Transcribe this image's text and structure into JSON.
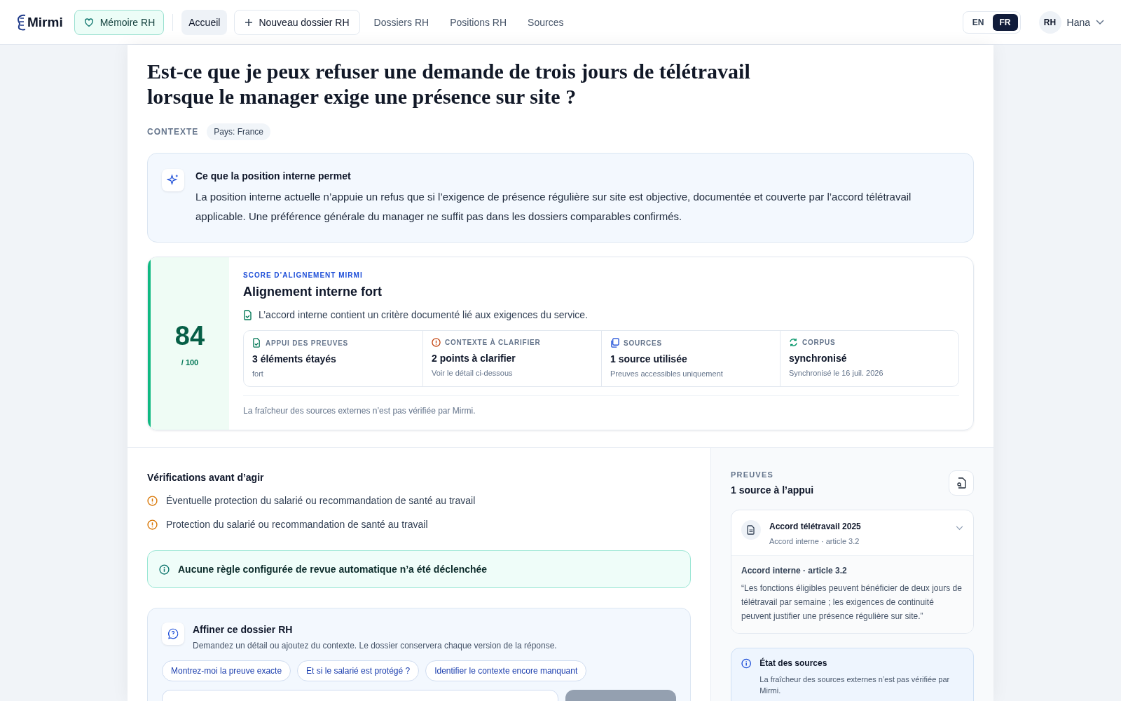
{
  "nav": {
    "logo": "Mirmi",
    "memory_badge": "Mémoire RH",
    "items": [
      {
        "label": "Accueil",
        "kind": "tab",
        "selected": true
      },
      {
        "label": "Nouveau dossier RH",
        "kind": "action",
        "selected": false
      },
      {
        "label": "Dossiers RH",
        "kind": "tab",
        "selected": false
      },
      {
        "label": "Positions RH",
        "kind": "tab",
        "selected": false
      },
      {
        "label": "Sources",
        "kind": "tab",
        "selected": false
      }
    ],
    "languages": [
      {
        "label": "EN",
        "selected": false
      },
      {
        "label": "FR",
        "selected": true
      }
    ],
    "user": {
      "initials": "RH",
      "name": "Hana"
    }
  },
  "question": "Est-ce que je peux refuser une demande de trois jours de télétravail lorsque le manager exige une présence sur site ?",
  "context": {
    "label": "CONTEXTE",
    "tags": [
      "Pays: France"
    ]
  },
  "summary": {
    "title": "Ce que la position interne permet",
    "text": "La position interne actuelle n’appuie un refus que si l’exigence de présence régulière sur site est objective, documentée et couverte par l’accord télétravail applicable. Une préférence générale du manager ne suffit pas dans les dossiers comparables confirmés."
  },
  "score": {
    "value": "84",
    "scale": "/ 100",
    "eyebrow": "SCORE D’ALIGNEMENT MIRMI",
    "title": "Alignement interne fort",
    "note": "L’accord interne contient un critère documenté lié aux exigences du service.",
    "metrics": [
      {
        "kind": "evidence",
        "label": "APPUI DES PREUVES",
        "value": "3 éléments étayés",
        "detail": "fort"
      },
      {
        "kind": "warning",
        "label": "CONTEXTE À CLARIFIER",
        "value": "2 points à clarifier",
        "detail": "Voir le détail ci-dessous"
      },
      {
        "kind": "sources",
        "label": "SOURCES",
        "value": "1 source utilisée",
        "detail": "Preuves accessibles uniquement"
      },
      {
        "kind": "sync",
        "label": "CORPUS",
        "value": "synchronisé",
        "detail": "Synchronisé le 16 juil. 2026"
      }
    ],
    "footer": "La fraîcheur des sources externes n’est pas vérifiée par Mirmi."
  },
  "checks": {
    "title": "Vérifications avant d’agir",
    "items": [
      "Éventuelle protection du salarié ou recommandation de santé au travail",
      "Protection du salarié ou recommandation de santé au travail"
    ]
  },
  "notice": "Aucune règle configurée de revue automatique n’a été déclenchée",
  "refine": {
    "title": "Affiner ce dossier RH",
    "text": "Demandez un détail ou ajoutez du contexte. Le dossier conservera chaque version de la réponse.",
    "suggestions": [
      "Montrez-moi la preuve exacte",
      "Et si le salarié est protégé ?",
      "Identifier le contexte encore manquant"
    ]
  },
  "evidence": {
    "eyebrow": "PREUVES",
    "title": "1 source à l’appui",
    "sources": [
      {
        "title": "Accord télétravail 2025",
        "subtitle": "Accord interne · article 3.2",
        "expanded": true,
        "excerpt_title": "Accord interne · article 3.2",
        "quote": "“Les fonctions éligibles peuvent bénéficier de deux jours de télétravail par semaine ; les exigences de continuité peuvent justifier une présence régulière sur site.”"
      }
    ],
    "status": {
      "title": "État des sources",
      "text": "La fraîcheur des sources externes n’est pas vérifiée par Mirmi."
    }
  }
}
